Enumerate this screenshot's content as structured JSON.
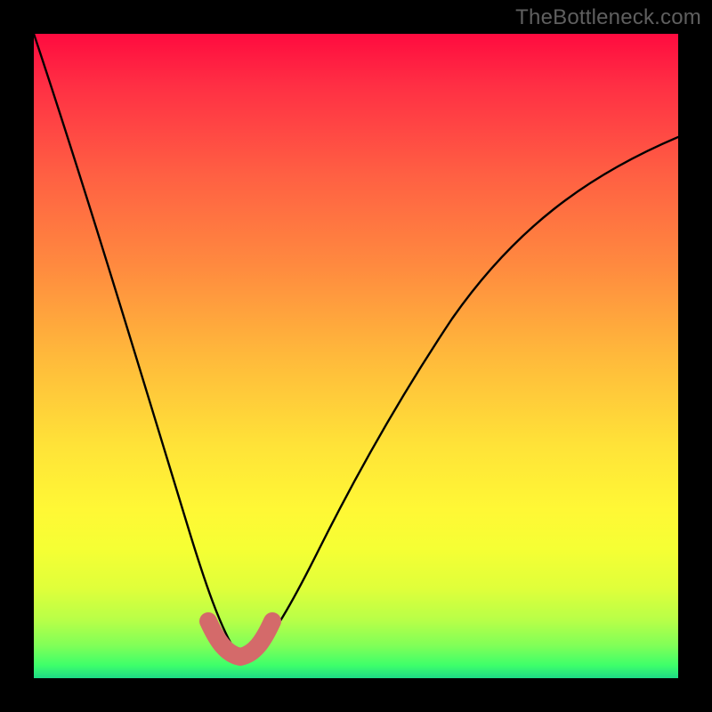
{
  "watermark": "TheBottleneck.com",
  "chart_data": {
    "type": "line",
    "title": "",
    "xlabel": "",
    "ylabel": "",
    "xlim": [
      0,
      100
    ],
    "ylim": [
      0,
      100
    ],
    "series": [
      {
        "name": "curve",
        "x": [
          0,
          3,
          6,
          9,
          12,
          15,
          18,
          21,
          23,
          25,
          27,
          29,
          31,
          33,
          35,
          38,
          42,
          46,
          50,
          55,
          60,
          66,
          72,
          78,
          85,
          92,
          100
        ],
        "values": [
          100,
          88,
          77,
          67,
          57,
          48,
          39,
          31,
          24,
          18,
          13,
          9,
          6,
          4,
          4,
          6,
          12,
          20,
          28,
          37,
          46,
          55,
          62,
          69,
          75,
          80,
          84
        ]
      }
    ],
    "marker": {
      "name": "trough",
      "x": [
        27,
        28.2,
        29.4,
        30.4,
        31.2,
        32,
        32.8,
        33.6,
        34.6,
        35.8,
        37
      ],
      "values": [
        8.8,
        6.6,
        5.0,
        4.0,
        3.4,
        3.2,
        3.4,
        4.0,
        5.0,
        6.6,
        8.8
      ],
      "color": "#d46a6a",
      "width": 20
    },
    "background": {
      "top_color": "#ff0b3f",
      "bottom_color": "#1dda86"
    }
  }
}
